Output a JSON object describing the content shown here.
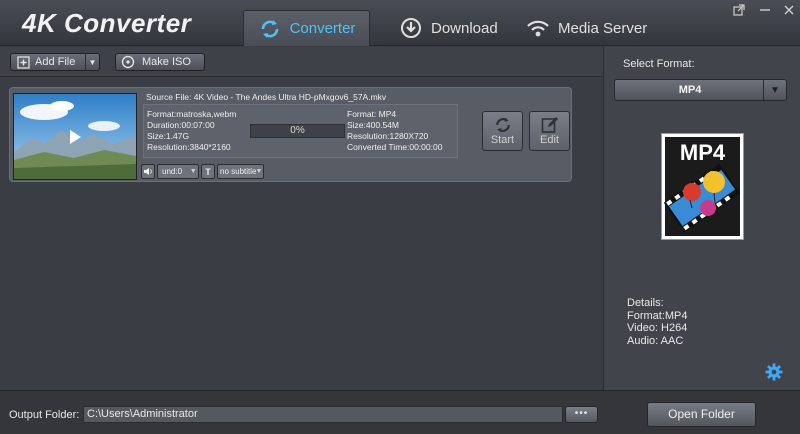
{
  "app": {
    "title": "4K Converter"
  },
  "tabs": [
    {
      "label": "Converter",
      "icon": "refresh-icon",
      "active": true
    },
    {
      "label": "Download",
      "icon": "download-icon",
      "active": false
    },
    {
      "label": "Media Server",
      "icon": "wifi-icon",
      "active": false
    }
  ],
  "window_controls": {
    "restore_icon": "external-link-icon",
    "minimize_icon": "minimize-icon",
    "close_icon": "close-icon"
  },
  "toolbar": {
    "add_file_label": "Add File",
    "make_iso_label": "Make ISO"
  },
  "file": {
    "source_line": "Source File: 4K Video - The Andes Ultra HD-pMxgov6_57A.mkv",
    "source": {
      "format": "Format:matroska,webm",
      "duration": "Duration:00:07:00",
      "size": "Size:1.47G",
      "resolution": "Resolution:3840*2160"
    },
    "progress": "0%",
    "target": {
      "format": "Format: MP4",
      "size": "Size:400.54M",
      "resolution": "Resolution:1280X720",
      "converted_time": "Converted Time:00:00:00"
    },
    "start_label": "Start",
    "edit_label": "Edit",
    "audio_track": "und:0",
    "subtitle": "no subtitle"
  },
  "right_panel": {
    "select_label": "Select Format:",
    "selected_format": "MP4",
    "format_badge": "MP4",
    "details": {
      "heading": "Details:",
      "format": "Format:MP4",
      "video": "Video: H264",
      "audio": "Audio: AAC"
    }
  },
  "bottom": {
    "output_label": "Output Folder:",
    "output_path": "C:\\Users\\Administrator",
    "browse_label": "•••",
    "open_folder_label": "Open Folder"
  },
  "colors": {
    "accent": "#4fc3f7",
    "background": "#3a3d44"
  }
}
